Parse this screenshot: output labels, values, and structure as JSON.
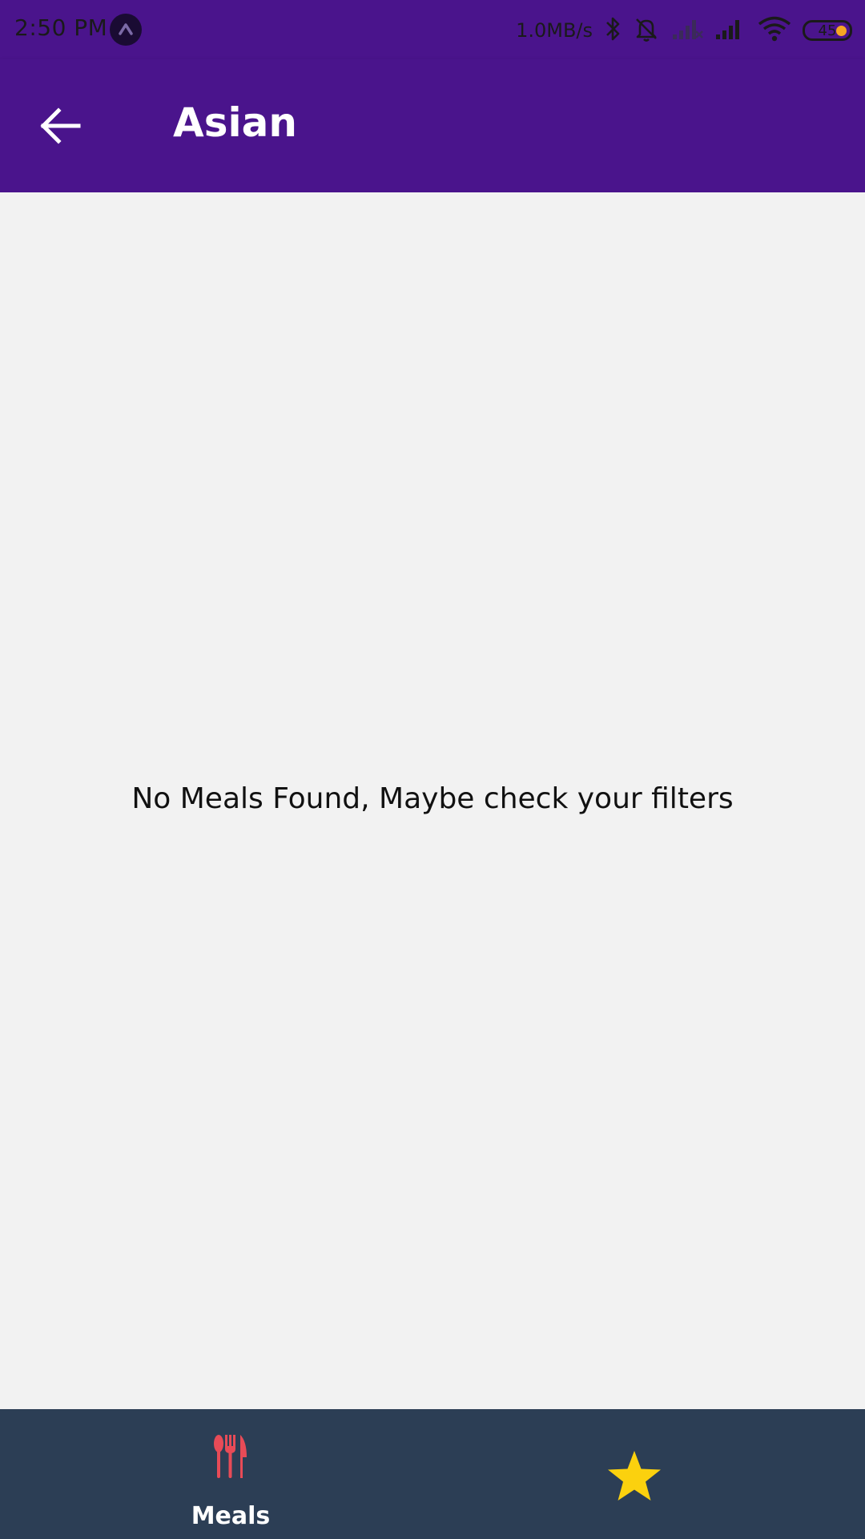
{
  "status_bar": {
    "time": "2:50 PM",
    "net_speed": "1.0MB/s",
    "battery_level": "45",
    "icons": [
      "app-notification-icon",
      "bluetooth-icon",
      "silent-bell-icon",
      "signal-empty-icon",
      "signal-icon",
      "wifi-icon",
      "battery-icon"
    ]
  },
  "app_bar": {
    "back_icon": "arrow-back-icon",
    "title": "Asian"
  },
  "content": {
    "empty_message": "No Meals Found, Maybe check your filters"
  },
  "bottom_nav": {
    "items": [
      {
        "label": "Meals",
        "icon": "restaurant-icon",
        "active": true
      },
      {
        "label": "",
        "icon": "star-icon",
        "active": false
      }
    ]
  },
  "colors": {
    "primary": "#4a148c",
    "background": "#f2f2f2",
    "bottom_nav": "#2c3e55",
    "meals_icon": "#e84b57",
    "star_icon": "#fbd10e"
  }
}
